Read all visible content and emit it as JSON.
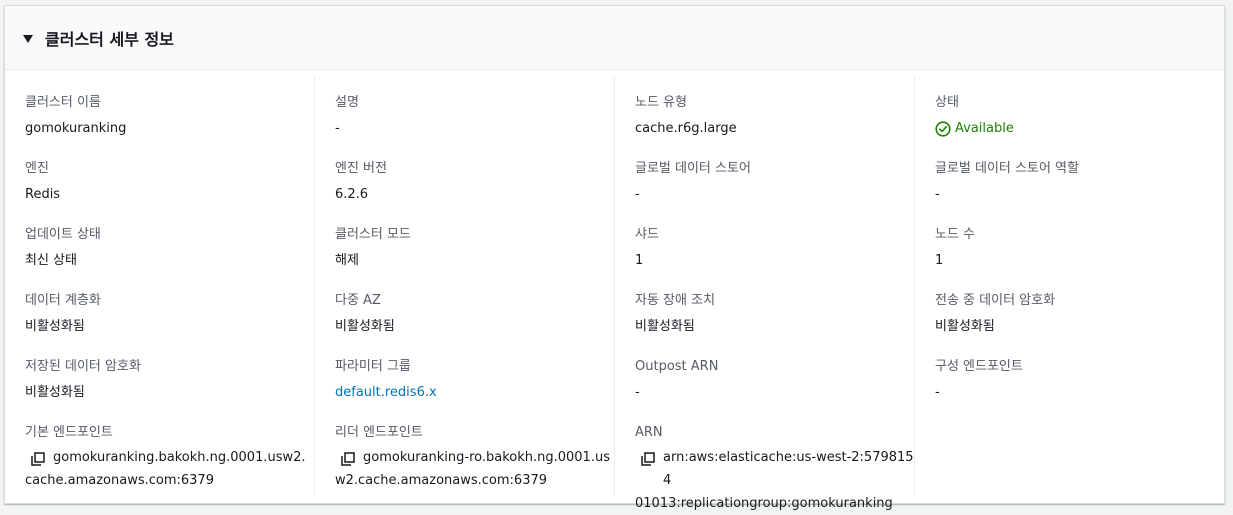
{
  "panel": {
    "title": "클러스터 세부 정보"
  },
  "columns": [
    [
      {
        "label": "클러스터 이름",
        "value": "gomokuranking"
      },
      {
        "label": "엔진",
        "value": "Redis"
      },
      {
        "label": "업데이트 상태",
        "value": "최신 상태"
      },
      {
        "label": "데이터 계층화",
        "value": "비활성화됨"
      },
      {
        "label": "저장된 데이터 암호화",
        "value": "비활성화됨"
      },
      {
        "label": "기본 엔드포인트",
        "value_line1": "gomokuranking.bakokh.ng.0001.usw2.",
        "value_line2": "cache.amazonaws.com:6379"
      }
    ],
    [
      {
        "label": "설명",
        "value": "-"
      },
      {
        "label": "엔진 버전",
        "value": "6.2.6"
      },
      {
        "label": "클러스터 모드",
        "value": "해제"
      },
      {
        "label": "다중 AZ",
        "value": "비활성화됨"
      },
      {
        "label": "파라미터 그룹",
        "value": "default.redis6.x"
      },
      {
        "label": "리더 엔드포인트",
        "value_line1": "gomokuranking-ro.bakokh.ng.0001.us",
        "value_line2": "w2.cache.amazonaws.com:6379"
      }
    ],
    [
      {
        "label": "노드 유형",
        "value": "cache.r6g.large"
      },
      {
        "label": "글로벌 데이터 스토어",
        "value": "-"
      },
      {
        "label": "샤드",
        "value": "1"
      },
      {
        "label": "자동 장애 조치",
        "value": "비활성화됨"
      },
      {
        "label": "Outpost ARN",
        "value": "-"
      },
      {
        "label": "ARN",
        "value_line1": "arn:aws:elasticache:us-west-2:5798154",
        "value_line2": "01013:replicationgroup:gomokuranking"
      }
    ],
    [
      {
        "label": "상태",
        "value": "Available"
      },
      {
        "label": "글로벌 데이터 스토어 역할",
        "value": "-"
      },
      {
        "label": "노드 수",
        "value": "1"
      },
      {
        "label": "전송 중 데이터 암호화",
        "value": "비활성화됨"
      },
      {
        "label": "구성 엔드포인트",
        "value": "-"
      }
    ]
  ],
  "colors": {
    "status_available": "#1d8102",
    "link": "#0073bb",
    "label": "#545b64"
  }
}
